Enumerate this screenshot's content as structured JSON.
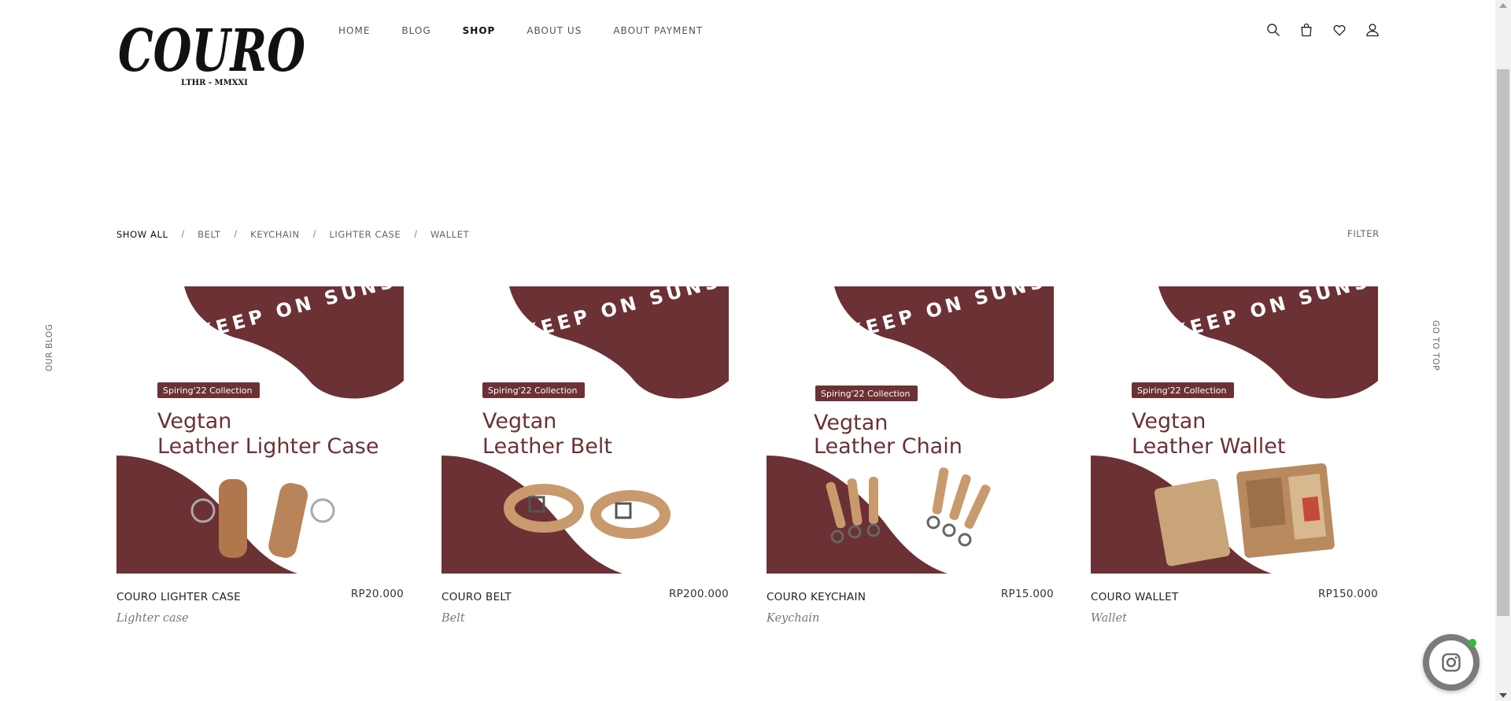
{
  "brand": {
    "logo_text": "COURO",
    "logo_subtext": "LTHR - MMXXI",
    "color_dark": "#111111"
  },
  "nav": {
    "items": [
      {
        "label": "HOME"
      },
      {
        "label": "BLOG"
      },
      {
        "label": "SHOP"
      },
      {
        "label": "ABOUT US"
      },
      {
        "label": "ABOUT PAYMENT"
      }
    ],
    "active": "SHOP"
  },
  "header_icons": [
    "search-icon",
    "cart-icon",
    "heart-icon",
    "user-icon"
  ],
  "filters": {
    "items": [
      {
        "label": "SHOW ALL"
      },
      {
        "label": "BELT"
      },
      {
        "label": "KEYCHAIN"
      },
      {
        "label": "LIGHTER CASE"
      },
      {
        "label": "WALLET"
      }
    ],
    "separator": "/",
    "filter_button": "FILTER"
  },
  "side": {
    "left_label": "OUR BLOG",
    "right_label": "GO TO TOP"
  },
  "banner": {
    "headline": "KEEP ON SUNSHINE",
    "collection": "Spiring'22 Collection",
    "brand_color": "#6b3134"
  },
  "products": [
    {
      "name": "COURO LIGHTER CASE",
      "price": "RP20.000",
      "category": "Lighter case",
      "title_line1": "Vegtan",
      "title_line2": "Leather Lighter Case"
    },
    {
      "name": "COURO BELT",
      "price": "RP200.000",
      "category": "Belt",
      "title_line1": "Vegtan",
      "title_line2": "Leather Belt"
    },
    {
      "name": "COURO KEYCHAIN",
      "price": "RP15.000",
      "category": "Keychain",
      "title_line1": "Vegtan",
      "title_line2": "Leather Chain"
    },
    {
      "name": "COURO WALLET",
      "price": "RP150.000",
      "category": "Wallet",
      "title_line1": "Vegtan",
      "title_line2": "Leather Wallet"
    }
  ],
  "floating": {
    "icon": "instagram-icon",
    "status_color": "#2fbf2f"
  }
}
